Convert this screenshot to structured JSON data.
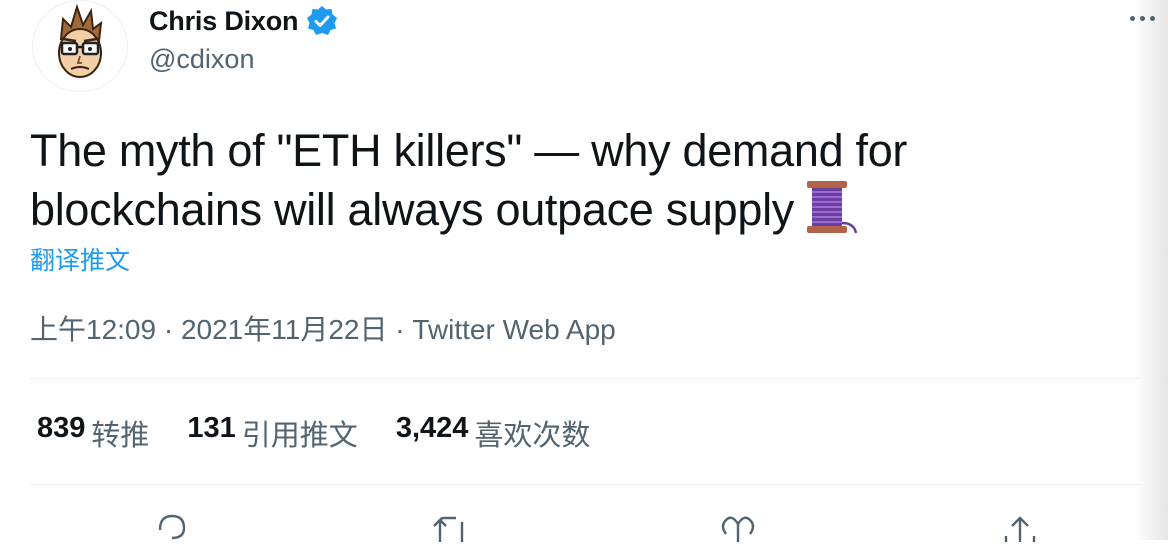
{
  "author": {
    "display_name": "Chris Dixon",
    "handle": "@cdixon",
    "verified": true
  },
  "tweet": {
    "text_line1": "The myth of \"ETH killers\" — why demand for",
    "text_line2": "blockchains will always outpace supply",
    "emoji": "spool-of-thread",
    "translate_label": "翻译推文"
  },
  "meta": {
    "time": "上午12:09",
    "date": "2021年11月22日",
    "source": "Twitter Web App",
    "separator": "·"
  },
  "stats": [
    {
      "count": "839",
      "label": "转推"
    },
    {
      "count": "131",
      "label": "引用推文"
    },
    {
      "count": "3,424",
      "label": "喜欢次数"
    }
  ],
  "actions": [
    "reply-icon",
    "retweet-icon",
    "like-icon",
    "share-icon"
  ],
  "colors": {
    "accent": "#1d9bf0",
    "text": "#0f1419",
    "secondary": "#536471"
  }
}
